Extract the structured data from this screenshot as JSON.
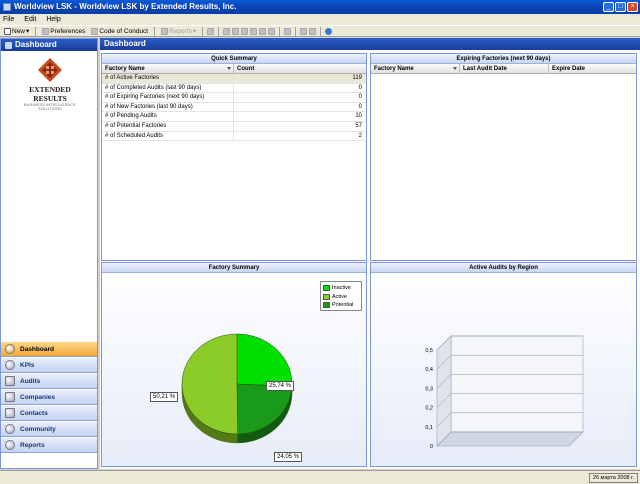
{
  "window": {
    "title": "Worldview LSK - Worldview LSK by Extended Results, Inc.",
    "min": "_",
    "max": "□",
    "close": "×"
  },
  "menu": [
    "File",
    "Edit",
    "Help"
  ],
  "toolbar": {
    "new": "New",
    "preferences": "Preferences",
    "code_of_conduct": "Code of Conduct",
    "reports": "Reports"
  },
  "left_pane": {
    "title": "Dashboard",
    "logo": {
      "name": "EXTENDED RESULTS",
      "tagline": "BUSINESS INTELLIGENCE SOLUTIONS"
    },
    "nav": [
      {
        "label": "Dashboard",
        "icon": "dashboard-icon",
        "active": true
      },
      {
        "label": "KPIs",
        "icon": "kpi-icon"
      },
      {
        "label": "Audits",
        "icon": "audits-icon"
      },
      {
        "label": "Companies",
        "icon": "companies-icon"
      },
      {
        "label": "Contacts",
        "icon": "contacts-icon"
      },
      {
        "label": "Community",
        "icon": "community-icon"
      },
      {
        "label": "Reports",
        "icon": "reports-icon"
      }
    ]
  },
  "main": {
    "title": "Dashboard",
    "quick_summary": {
      "title": "Quick Summary",
      "columns": [
        "Factory Name",
        "Count"
      ],
      "rows": [
        {
          "name": "# of Active Factories",
          "count": "119"
        },
        {
          "name": "# of Completed Audits (last 90 days)",
          "count": "0"
        },
        {
          "name": "# of Expiring Factories (next 90 days)",
          "count": "0"
        },
        {
          "name": "# of New Factories (last 90 days)",
          "count": "0"
        },
        {
          "name": "# of Pending Audits",
          "count": "10"
        },
        {
          "name": "# of Potential Factories",
          "count": "57"
        },
        {
          "name": "# of Scheduled Audits",
          "count": "2"
        }
      ]
    },
    "expiring": {
      "title": "Expiring Factories (next 90 days)",
      "columns": [
        "Factory Name",
        "Last Audit Date",
        "Expire Date"
      ]
    },
    "factory_summary": {
      "title": "Factory Summary"
    },
    "active_audits": {
      "title": "Active Audits by Region"
    }
  },
  "chart_data": [
    {
      "type": "pie",
      "title": "Factory Summary",
      "legend_position": "top-right",
      "series": [
        {
          "name": "Inactive",
          "value": 25.74,
          "label": "25,74 %",
          "color": "#00e000"
        },
        {
          "name": "Active",
          "value": 50.21,
          "label": "50,21 %",
          "color": "#8ccc28"
        },
        {
          "name": "Potential",
          "value": 24.05,
          "label": "24,05 %",
          "color": "#1a9a1a"
        }
      ]
    },
    {
      "type": "bar",
      "title": "Active Audits by Region",
      "categories": [],
      "values": [],
      "ylim": [
        0,
        0.5
      ],
      "yticks": [
        "0",
        "0,1",
        "0,2",
        "0,3",
        "0,4",
        "0,5"
      ],
      "grid": true
    }
  ],
  "status": {
    "date": "26 марта 2008 г."
  }
}
